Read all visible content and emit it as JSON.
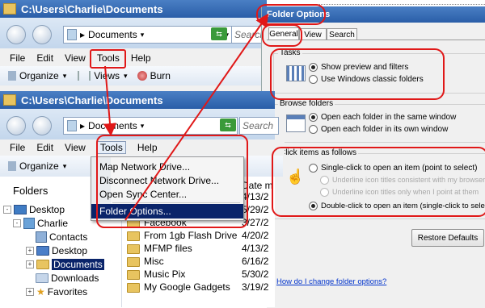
{
  "back_window": {
    "title": "C:\\Users\\Charlie\\Documents",
    "breadcrumb": "Documents",
    "search_placeholder": "Search",
    "menu": [
      "File",
      "Edit",
      "View",
      "Tools",
      "Help"
    ],
    "toolbar": [
      "Organize",
      "Views",
      "Burn"
    ]
  },
  "front_window": {
    "title": "C:\\Users\\Charlie\\Documents",
    "breadcrumb": "Documents",
    "search_placeholder": "Search",
    "menu": [
      "File",
      "Edit",
      "View",
      "Tools",
      "Help"
    ],
    "toolbar": [
      "Organize"
    ],
    "pane_title": "Folders",
    "tree": [
      {
        "label": "Desktop",
        "level": 0,
        "expander": "-",
        "icon": "desktop"
      },
      {
        "label": "Charlie",
        "level": 1,
        "expander": "-",
        "icon": "user"
      },
      {
        "label": "Contacts",
        "level": 2,
        "expander": "",
        "icon": "contacts"
      },
      {
        "label": "Desktop",
        "level": 2,
        "expander": "+",
        "icon": "folder"
      },
      {
        "label": "Documents",
        "level": 2,
        "expander": "+",
        "icon": "folder",
        "selected": true
      },
      {
        "label": "Downloads",
        "level": 2,
        "expander": "",
        "icon": "folder"
      },
      {
        "label": "Favorites",
        "level": 2,
        "expander": "+",
        "icon": "star"
      }
    ],
    "date_header": "Date m",
    "files": [
      {
        "name": "",
        "date": "4/13/2"
      },
      {
        "name": "",
        "date": "5/29/2"
      },
      {
        "name": "Facebook",
        "date": "3/27/2"
      },
      {
        "name": "From 1gb Flash Drive",
        "date": "4/20/2"
      },
      {
        "name": "MFMP files",
        "date": "4/13/2"
      },
      {
        "name": "Misc",
        "date": "6/16/2"
      },
      {
        "name": "Music Pix",
        "date": "5/30/2"
      },
      {
        "name": "My Google Gadgets",
        "date": "3/19/2"
      }
    ],
    "tools_menu": [
      "Map Network Drive...",
      "Disconnect Network Drive...",
      "Open Sync Center...",
      "Folder Options..."
    ]
  },
  "folder_options": {
    "title": "Folder Options",
    "tabs": [
      "General",
      "View",
      "Search"
    ],
    "tasks_label": "Tasks",
    "tasks_options": [
      "Show preview and filters",
      "Use Windows classic folders"
    ],
    "browse_label": "Browse folders",
    "browse_options": [
      "Open each folder in the same window",
      "Open each folder in its own window"
    ],
    "click_label": "Click items as follows",
    "click_options": [
      "Single-click to open an item (point to select)",
      "Underline icon titles consistent with my browser",
      "Underline icon titles only when I point at them",
      "Double-click to open an item (single-click to select)"
    ],
    "restore_button": "Restore Defaults",
    "help_link": "How do I change folder options?"
  },
  "colors": {
    "annotation": "#e01818",
    "selection": "#0a246a",
    "titlebar": "#2a5ea8",
    "link": "#0033cc"
  }
}
